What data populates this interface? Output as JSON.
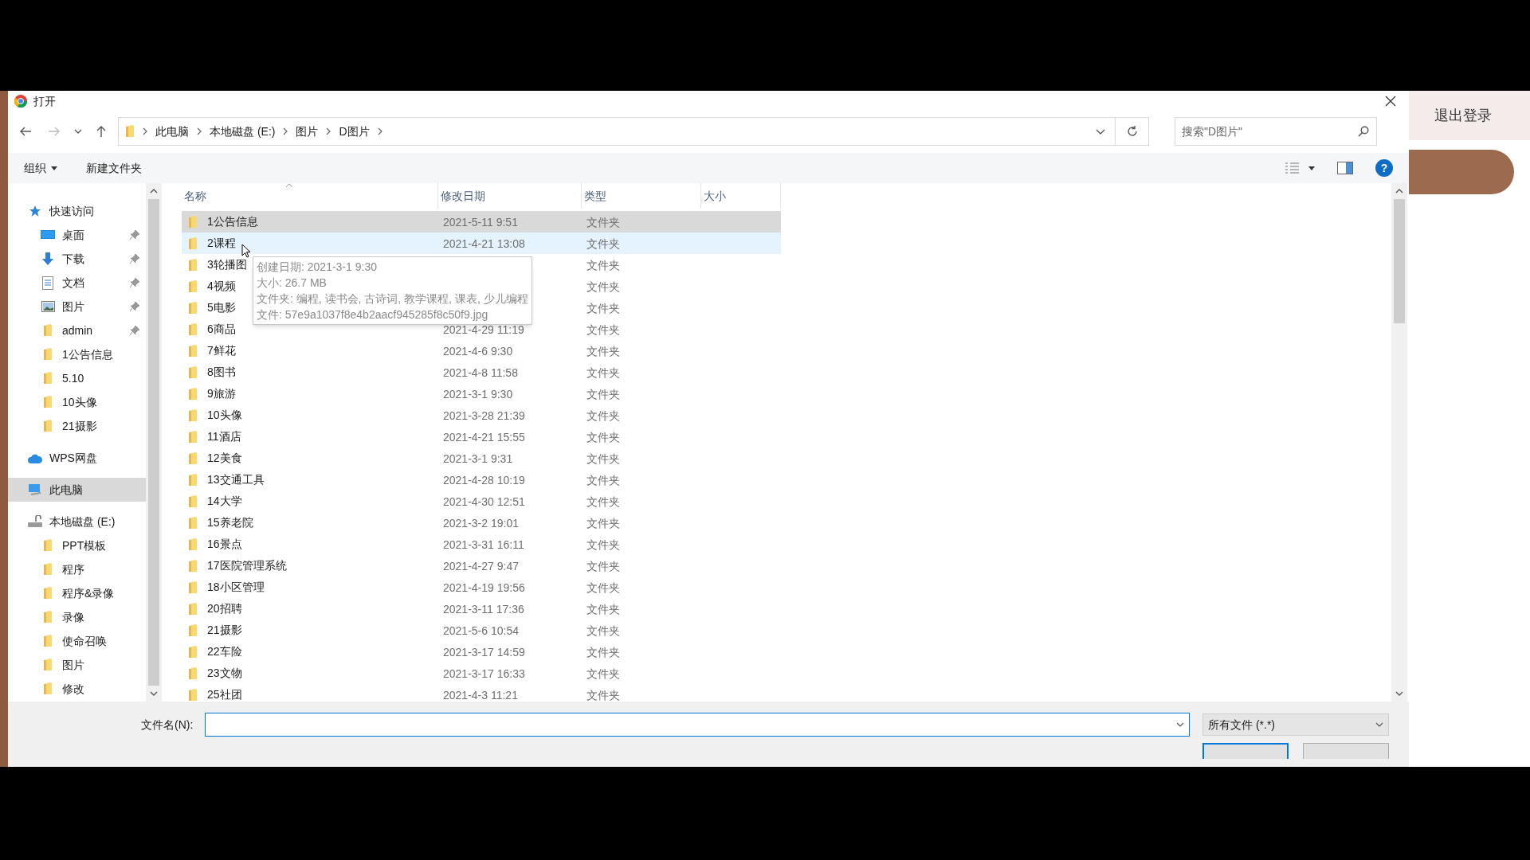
{
  "window": {
    "title": "打开"
  },
  "address_bar": {
    "path": [
      "此电脑",
      "本地磁盘 (E:)",
      "图片",
      "D图片"
    ]
  },
  "search": {
    "placeholder": "搜索\"D图片\""
  },
  "toolbar": {
    "organize": "组织",
    "new_folder": "新建文件夹",
    "help": "?"
  },
  "sidebar": {
    "items": [
      {
        "kind": "quick_access",
        "label": "快速访问",
        "selected": false,
        "children": [
          {
            "kind": "desktop",
            "label": "桌面",
            "pinned": true,
            "selected": false
          },
          {
            "kind": "downloads",
            "label": "下载",
            "pinned": true,
            "selected": false
          },
          {
            "kind": "documents",
            "label": "文档",
            "pinned": true,
            "selected": false
          },
          {
            "kind": "pictures",
            "label": "图片",
            "pinned": true,
            "selected": false
          },
          {
            "kind": "folder",
            "label": "admin",
            "pinned": true,
            "selected": false
          },
          {
            "kind": "folder",
            "label": "1公告信息",
            "pinned": false,
            "selected": false
          },
          {
            "kind": "folder",
            "label": "5.10",
            "pinned": false,
            "selected": false
          },
          {
            "kind": "folder",
            "label": "10头像",
            "pinned": false,
            "selected": false
          },
          {
            "kind": "folder",
            "label": "21摄影",
            "pinned": false,
            "selected": false
          }
        ]
      },
      {
        "kind": "cloud",
        "label": "WPS网盘",
        "selected": false
      },
      {
        "kind": "pc",
        "label": "此电脑",
        "selected": true
      },
      {
        "kind": "drive",
        "label": "本地磁盘 (E:)",
        "selected": false,
        "children": [
          {
            "kind": "folder",
            "label": "PPT模板",
            "selected": false
          },
          {
            "kind": "folder",
            "label": "程序",
            "selected": false
          },
          {
            "kind": "folder",
            "label": "程序&录像",
            "selected": false
          },
          {
            "kind": "folder",
            "label": "录像",
            "selected": false
          },
          {
            "kind": "folder",
            "label": "使命召唤",
            "selected": false
          },
          {
            "kind": "folder",
            "label": "图片",
            "selected": false
          },
          {
            "kind": "folder",
            "label": "修改",
            "selected": false
          }
        ]
      }
    ]
  },
  "table": {
    "columns": [
      "名称",
      "修改日期",
      "类型",
      "大小"
    ],
    "rows": [
      {
        "name": "1公告信息",
        "date": "2021-5-11 9:51",
        "type": "文件夹",
        "selected": true,
        "hovered": false
      },
      {
        "name": "2课程",
        "date": "2021-4-21 13:08",
        "type": "文件夹",
        "selected": false,
        "hovered": true
      },
      {
        "name": "3轮播图",
        "type": "文件夹",
        "selected": false,
        "hovered": false
      },
      {
        "name": "4视频",
        "type": "文件夹",
        "selected": false,
        "hovered": false
      },
      {
        "name": "5电影",
        "type": "文件夹",
        "selected": false,
        "hovered": false
      },
      {
        "name": "6商品",
        "date": "2021-4-29 11:19",
        "type": "文件夹",
        "selected": false,
        "hovered": false
      },
      {
        "name": "7鲜花",
        "date": "2021-4-6 9:30",
        "type": "文件夹",
        "selected": false,
        "hovered": false
      },
      {
        "name": "8图书",
        "date": "2021-4-8 11:58",
        "type": "文件夹",
        "selected": false,
        "hovered": false
      },
      {
        "name": "9旅游",
        "date": "2021-3-1 9:30",
        "type": "文件夹",
        "selected": false,
        "hovered": false
      },
      {
        "name": "10头像",
        "date": "2021-3-28 21:39",
        "type": "文件夹",
        "selected": false,
        "hovered": false
      },
      {
        "name": "11酒店",
        "date": "2021-4-21 15:55",
        "type": "文件夹",
        "selected": false,
        "hovered": false
      },
      {
        "name": "12美食",
        "date": "2021-3-1 9:31",
        "type": "文件夹",
        "selected": false,
        "hovered": false
      },
      {
        "name": "13交通工具",
        "date": "2021-4-28 10:19",
        "type": "文件夹",
        "selected": false,
        "hovered": false
      },
      {
        "name": "14大学",
        "date": "2021-4-30 12:51",
        "type": "文件夹",
        "selected": false,
        "hovered": false
      },
      {
        "name": "15养老院",
        "date": "2021-3-2 19:01",
        "type": "文件夹",
        "selected": false,
        "hovered": false
      },
      {
        "name": "16景点",
        "date": "2021-3-31 16:11",
        "type": "文件夹",
        "selected": false,
        "hovered": false
      },
      {
        "name": "17医院管理系统",
        "date": "2021-4-27 9:47",
        "type": "文件夹",
        "selected": false,
        "hovered": false
      },
      {
        "name": "18小区管理",
        "date": "2021-4-19 19:56",
        "type": "文件夹",
        "selected": false,
        "hovered": false
      },
      {
        "name": "20招聘",
        "date": "2021-3-11 17:36",
        "type": "文件夹",
        "selected": false,
        "hovered": false
      },
      {
        "name": "21摄影",
        "date": "2021-5-6 10:54",
        "type": "文件夹",
        "selected": false,
        "hovered": false
      },
      {
        "name": "22车险",
        "date": "2021-3-17 14:59",
        "type": "文件夹",
        "selected": false,
        "hovered": false
      },
      {
        "name": "23文物",
        "date": "2021-3-17 16:33",
        "type": "文件夹",
        "selected": false,
        "hovered": false
      },
      {
        "name": "25社团",
        "date": "2021-4-3 11:21",
        "type": "文件夹",
        "selected": false,
        "hovered": false
      }
    ]
  },
  "tooltip": {
    "lines": [
      "创建日期: 2021-3-1 9:30",
      "大小: 26.7 MB",
      "文件夹: 编程, 读书会, 古诗词, 教学课程, 课表, 少儿编程",
      "文件: 57e9a1037f8e4b2aacf945285f8c50f9.jpg"
    ]
  },
  "footer": {
    "filename_label": "文件名(N):",
    "filter": "所有文件 (*.*)"
  },
  "background_app": {
    "logout": "退出登录"
  }
}
